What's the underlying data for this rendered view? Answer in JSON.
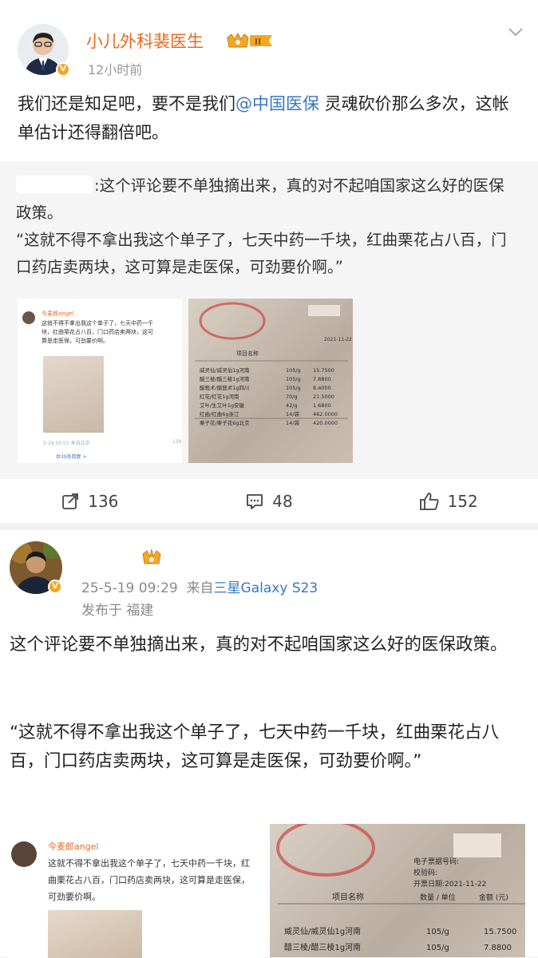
{
  "post1": {
    "author": "小儿外科裴医生",
    "level_badge": "II",
    "time": "12小时前",
    "text_before_mention": "我们还是知足吧，要不是我们",
    "mention": "@中国医保",
    "text_after_mention": " 灵魂砍价那么多次，这帐单估计还得翻倍吧。",
    "repost": {
      "text_line1": ":这个评论要不单独摘出来，真的对不起咱国家这么好的医保政策。",
      "text_line2": "“这就不得不拿出我这个单子了，七天中药一千块，红曲栗花占八百，门口药店卖两块，这可算是走医保，可劲要价啊。”",
      "thumb_left": {
        "user": "今麦郎angel",
        "text": "这就不得不拿出我这个单子了，七天中药一千块，红曲栗花占八百，门口药店卖两块，这可算是走医保，可劲要价啊。",
        "footer_time": "5-19 00:01 来自北京",
        "footer_likes": "139",
        "footer_replies": "共39条回复 >"
      },
      "thumb_right": {
        "date": "2021-11-22",
        "col_header": "项目名称",
        "rows": [
          {
            "name": "威灵仙/威灵仙1g河南",
            "unit": "105/g",
            "amount": "15.7500"
          },
          {
            "name": "醋三棱/醋三棱1g河南",
            "unit": "105/g",
            "amount": "7.8800"
          },
          {
            "name": "醋莪术/醋莪术1g四川",
            "unit": "105/g",
            "amount": "8.4000"
          },
          {
            "name": "红花/红花1g河南",
            "unit": "70/g",
            "amount": "21.5000"
          },
          {
            "name": "艾叶/生艾叶1g安徽",
            "unit": "42/g",
            "amount": "1.6800"
          },
          {
            "name": "红曲/红曲6g浙江",
            "unit": "14/袋",
            "amount": "462.0000"
          },
          {
            "name": "栗子花/栗子花6g北京",
            "unit": "14/袋",
            "amount": "420.0000"
          }
        ]
      }
    },
    "actions": {
      "repost_count": "136",
      "comment_count": "48",
      "like_count": "152"
    }
  },
  "post2": {
    "timestamp": "25-5-19 09:29",
    "source_prefix": "来自",
    "source_device": "三星Galaxy S23",
    "location": "发布于 福建",
    "paragraph1": "这个评论要不单独摘出来，真的对不起咱国家这么好的医保政策。",
    "paragraph2": "“这就不得不拿出我这个单子了，七天中药一千块，红曲栗花占八百，门口药店卖两块，这可算是走医保，可劲要价啊。”",
    "thumb_left": {
      "user": "今麦郎angel",
      "text": "这就不得不拿出我这个单子了，七天中药一千块，红曲栗花占八百，门口药店卖两块，这可算是走医保，可劲要价啊。"
    },
    "thumb_right": {
      "line_e_invoice": "电子票据号码:",
      "line_check": "校验码:",
      "line_date": "开票日期:2021-11-22",
      "col_name": "项目名称",
      "col_qty": "数量 / 单位",
      "col_amount": "金额 (元)",
      "rows": [
        {
          "name": "威灵仙/威灵仙1g河南",
          "unit": "105/g",
          "amount": "15.7500"
        },
        {
          "name": "醋三棱/醋三棱1g河南",
          "unit": "105/g",
          "amount": "7.8800"
        }
      ]
    }
  },
  "colors": {
    "author_name": "#e86a1f",
    "link": "#3777c5",
    "vip_badge": "#f5a623"
  }
}
